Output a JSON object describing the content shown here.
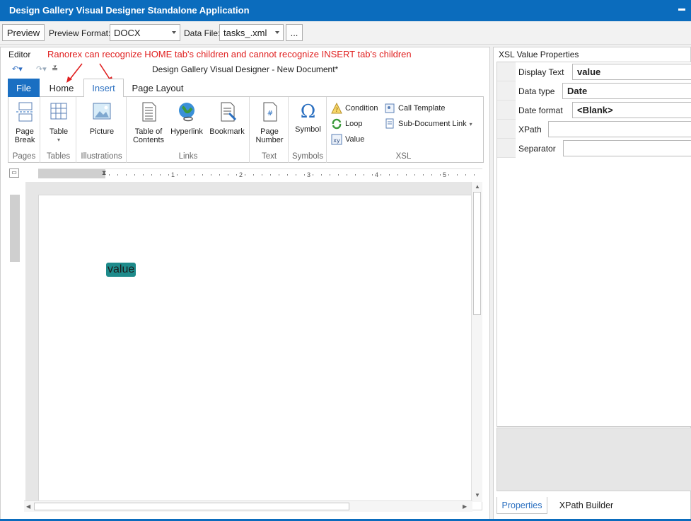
{
  "window": {
    "title": "Design Gallery Visual Designer Standalone Application"
  },
  "toolbar": {
    "preview_label": "Preview",
    "preview_format_label": "Preview Format:",
    "preview_format_value": "DOCX",
    "data_file_label": "Data File:",
    "data_file_value": "tasks_.xml",
    "browse_label": "..."
  },
  "editor": {
    "panel_label": "Editor",
    "annotation": "Ranorex can recognize HOME tab's children and cannot recognize INSERT tab's children",
    "document_title": "Design Gallery Visual Designer - New Document*",
    "tabs": [
      {
        "label": "File"
      },
      {
        "label": "Home"
      },
      {
        "label": "Insert",
        "active": true
      },
      {
        "label": "Page Layout"
      }
    ],
    "groups": {
      "pages": {
        "label": "Pages",
        "page_break": "Page Break"
      },
      "tables": {
        "label": "Tables",
        "table": "Table"
      },
      "illustrations": {
        "label": "Illustrations",
        "picture": "Picture"
      },
      "links": {
        "label": "Links",
        "toc": "Table of Contents",
        "hyperlink": "Hyperlink",
        "bookmark": "Bookmark"
      },
      "text": {
        "label": "Text",
        "page_number": "Page Number"
      },
      "symbols": {
        "label": "Symbols",
        "symbol": "Symbol"
      },
      "xsl": {
        "label": "XSL",
        "condition": "Condition",
        "loop": "Loop",
        "value": "Value",
        "call_template": "Call Template",
        "sub_document_link": "Sub-Document Link"
      }
    },
    "ruler_ticks": [
      "1",
      "2",
      "3",
      "4",
      "5"
    ],
    "field_text": "value"
  },
  "properties": {
    "title": "XSL Value Properties",
    "rows": [
      {
        "name": "Display Text",
        "value": "value"
      },
      {
        "name": "Data type",
        "value": "Date"
      },
      {
        "name": "Date format",
        "value": "<Blank>"
      },
      {
        "name": "XPath",
        "value": ""
      },
      {
        "name": "Separator",
        "value": ""
      }
    ],
    "tabs": [
      {
        "label": "Properties"
      },
      {
        "label": "XPath Builder"
      }
    ]
  },
  "colors": {
    "accent": "#0b6cbd",
    "field": "#1e8b8b",
    "annotation": "#e02020"
  }
}
